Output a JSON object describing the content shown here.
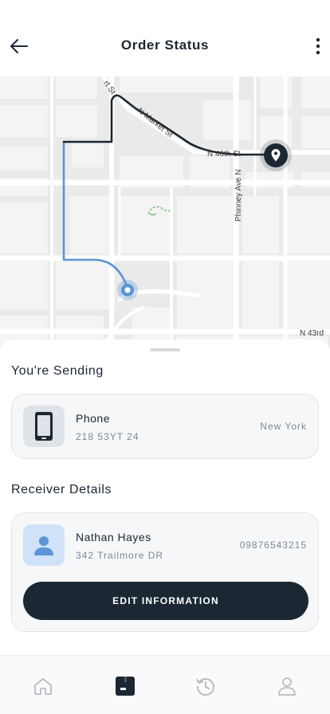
{
  "header": {
    "title": "Order Status"
  },
  "map": {
    "streets": {
      "s1": "rt St",
      "s2": "N Market St",
      "s3": "N 46th St",
      "s4": "Phinney Ave N",
      "s5": "N 43rd"
    },
    "route_color_active": "#1b2733",
    "route_color_done": "#5b95d6"
  },
  "sending": {
    "title": "You're Sending",
    "item_name": "Phone",
    "item_code": "218 53YT 24",
    "city": "New York"
  },
  "receiver": {
    "title": "Receiver Details",
    "name": "Nathan Hayes",
    "address": "342 Trailmore DR",
    "phone": "09876543215",
    "edit_label": "EDIT INFORMATION"
  },
  "colors": {
    "accent_dark": "#1b2733",
    "avatar_bg": "#cfe2f7",
    "avatar_fg": "#5b95d6"
  },
  "nav": {
    "items": [
      "home-icon",
      "orders-icon",
      "history-icon",
      "profile-icon"
    ],
    "active": "orders-icon"
  }
}
